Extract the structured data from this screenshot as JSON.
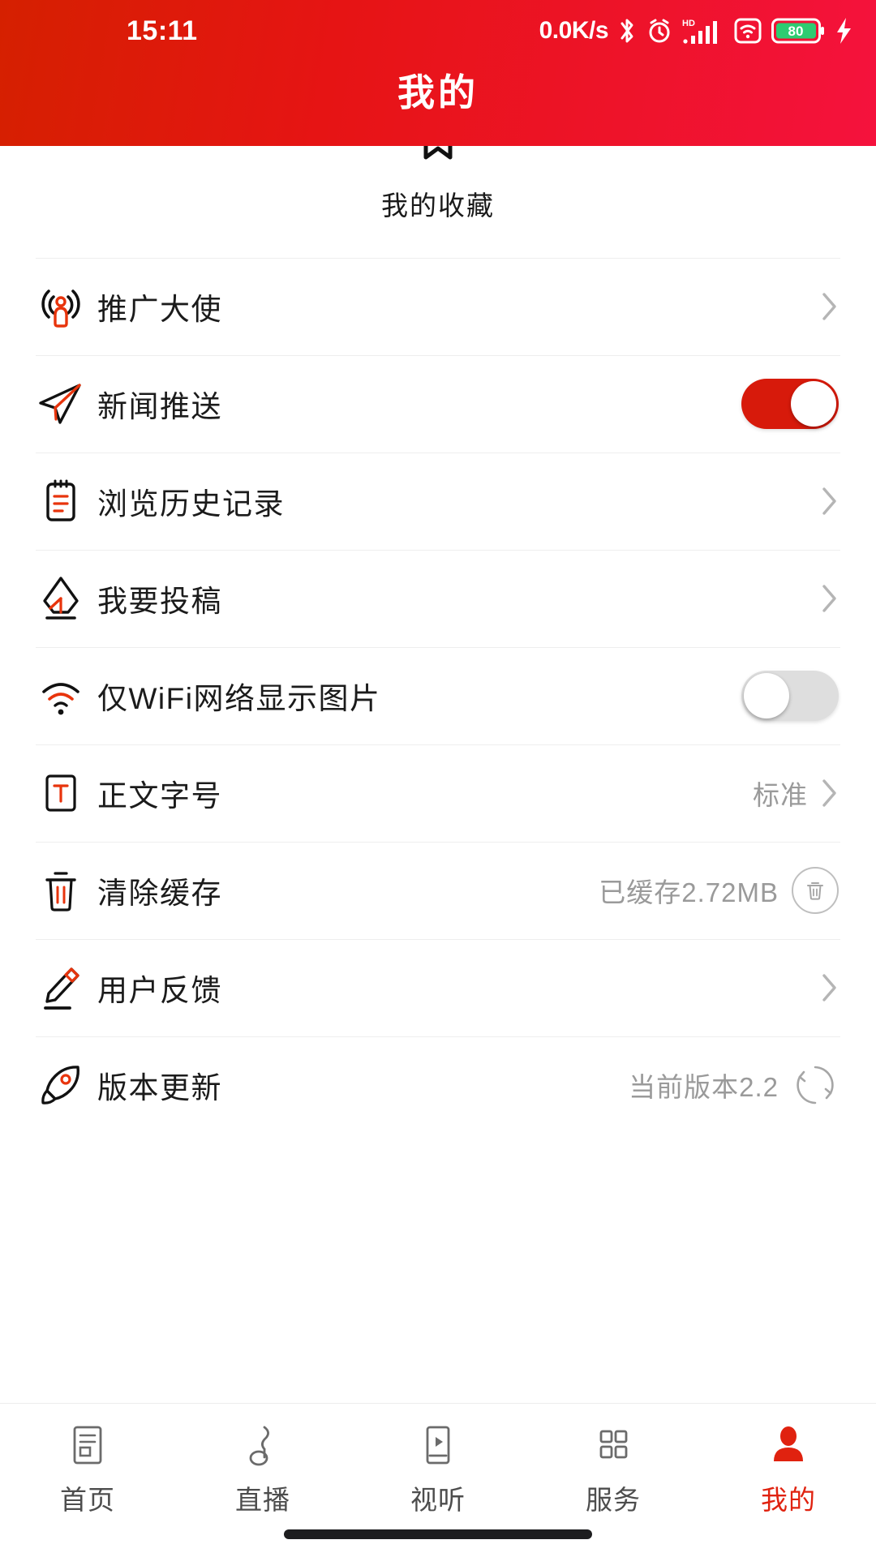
{
  "statusbar": {
    "time": "15:11",
    "netspeed": "0.0K/s",
    "bluetooth_icon": "bluetooth-icon",
    "alarm_icon": "alarm-clock-icon",
    "hd_label": "HD",
    "signal_icon": "signal-bars-icon",
    "wifi_icon": "wifi-box-icon",
    "battery_level": "80",
    "charging_icon": "charging-bolt-icon"
  },
  "header": {
    "title": "我的",
    "gradient_start": "#d52000",
    "gradient_end": "#f5123d"
  },
  "favorites": {
    "icon": "bookmark-icon",
    "label": "我的收藏"
  },
  "accent_color": "#e0220f",
  "list": [
    {
      "key": "promotion-ambassador",
      "icon": "broadcast-person-icon",
      "label": "推广大使",
      "control": "chevron",
      "value": ""
    },
    {
      "key": "news-push",
      "icon": "paper-plane-icon",
      "label": "新闻推送",
      "control": "toggle",
      "toggle_state": "on",
      "value": ""
    },
    {
      "key": "browse-history",
      "icon": "clipboard-icon",
      "label": "浏览历史记录",
      "control": "chevron",
      "value": ""
    },
    {
      "key": "submit-article",
      "icon": "pen-nib-icon",
      "label": "我要投稿",
      "control": "chevron",
      "value": ""
    },
    {
      "key": "wifi-only-images",
      "icon": "wifi-icon",
      "label": "仅WiFi网络显示图片",
      "control": "toggle",
      "toggle_state": "off",
      "value": ""
    },
    {
      "key": "body-font-size",
      "icon": "text-size-icon",
      "label": "正文字号",
      "control": "chevron",
      "value": "标准"
    },
    {
      "key": "clear-cache",
      "icon": "trash-icon",
      "label": "清除缓存",
      "control": "circle-trash",
      "value": "已缓存2.72MB"
    },
    {
      "key": "user-feedback",
      "icon": "pencil-icon",
      "label": "用户反馈",
      "control": "chevron",
      "value": ""
    },
    {
      "key": "version-update",
      "icon": "rocket-icon",
      "label": "版本更新",
      "control": "circle-refresh",
      "value": "当前版本2.2"
    }
  ],
  "tabbar": [
    {
      "key": "home",
      "icon": "news-list-icon",
      "label": "首页",
      "active": false
    },
    {
      "key": "live",
      "icon": "music-note-icon",
      "label": "直播",
      "active": false
    },
    {
      "key": "video",
      "icon": "video-play-icon",
      "label": "视听",
      "active": false
    },
    {
      "key": "services",
      "icon": "grid-icon",
      "label": "服务",
      "active": false
    },
    {
      "key": "mine",
      "icon": "person-icon",
      "label": "我的",
      "active": true
    }
  ]
}
